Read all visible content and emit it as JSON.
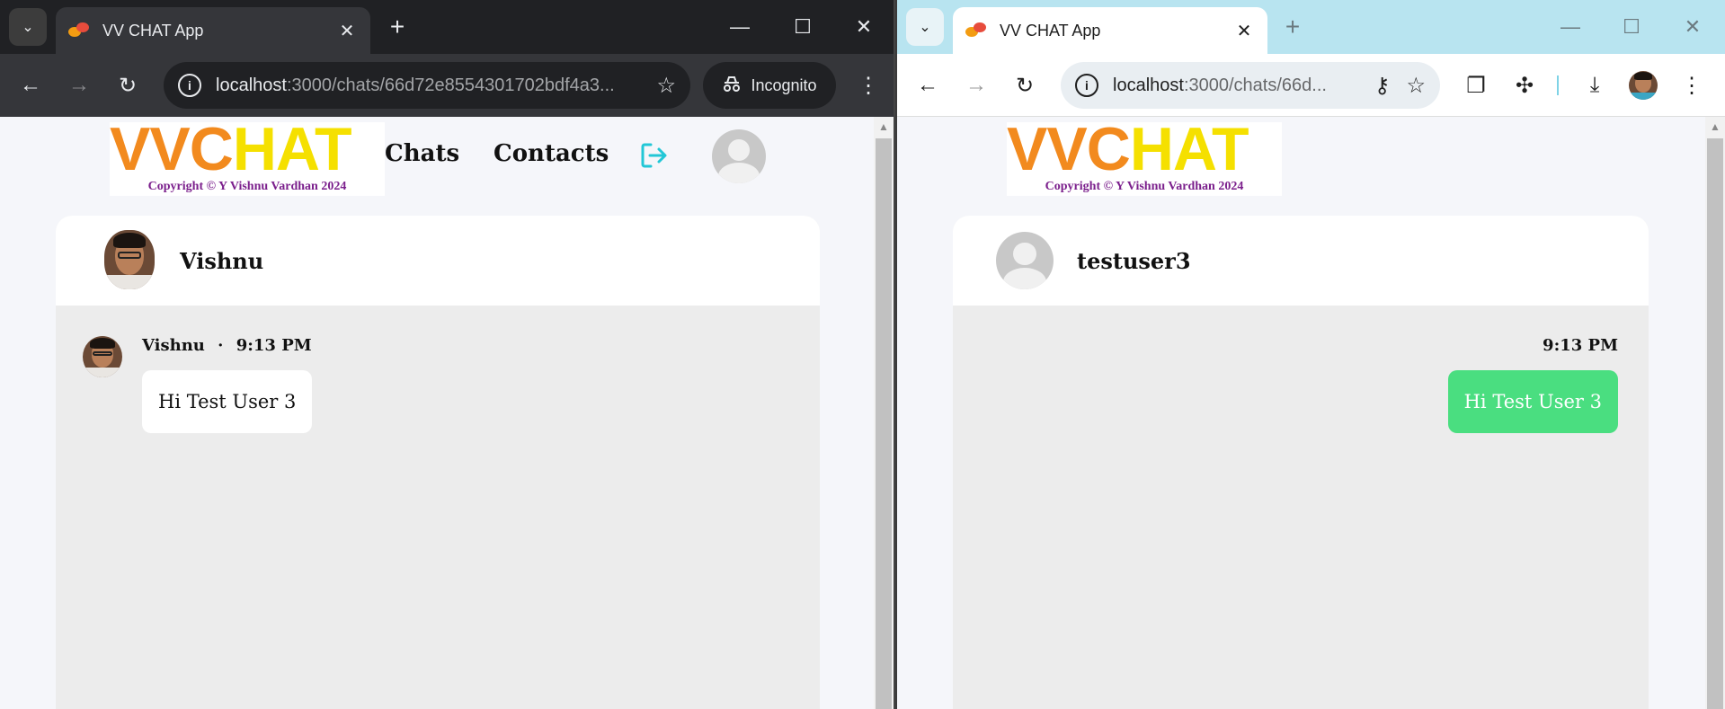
{
  "left_window": {
    "tab_title": "VV CHAT App",
    "url_host": "localhost",
    "url_path": ":3000/chats/66d72e8554301702bdf4a3...",
    "incognito_label": "Incognito",
    "app": {
      "logo_text_1": "VV",
      "logo_text_2": "C",
      "logo_text_3": "HAT",
      "copyright": "Copyright © Y Vishnu Vardhan 2024",
      "nav_chats": "Chats",
      "nav_contacts": "Contacts",
      "chat_partner": "Vishnu",
      "message": {
        "sender": "Vishnu",
        "separator": "·",
        "time": "9:13 PM",
        "text": "Hi Test User 3"
      }
    }
  },
  "right_window": {
    "tab_title": "VV CHAT App",
    "url_host": "localhost",
    "url_path": ":3000/chats/66d...",
    "app": {
      "logo_text_1": "VV",
      "logo_text_2": "C",
      "logo_text_3": "HAT",
      "copyright": "Copyright © Y Vishnu Vardhan 2024",
      "chat_partner": "testuser3",
      "message": {
        "time": "9:13 PM",
        "text": "Hi Test User 3"
      }
    }
  },
  "colors": {
    "accent_logout": "#22c7d6",
    "sent_bubble": "#4ade80",
    "logo_orange": "#f28a1e",
    "logo_yellow": "#f5e000",
    "copyright_purple": "#7b1f8c"
  }
}
